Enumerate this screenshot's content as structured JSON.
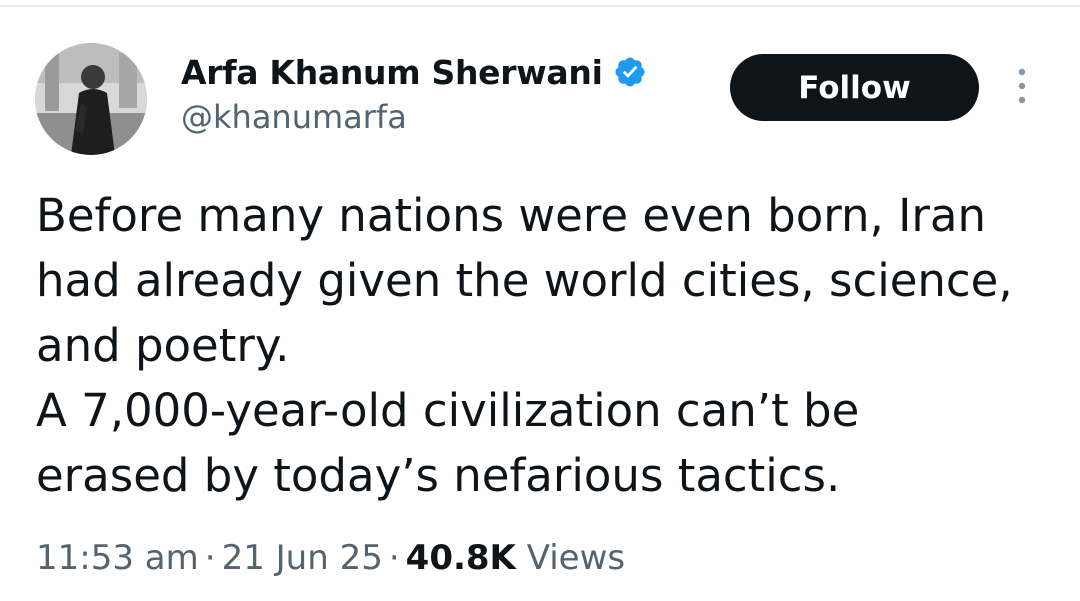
{
  "colors": {
    "text_primary": "#0f1419",
    "text_secondary": "#536471",
    "verified_blue": "#1d9bf0",
    "follow_bg": "#0f1419",
    "follow_text": "#ffffff"
  },
  "author": {
    "display_name": "Arfa Khanum Sherwani",
    "handle": "@khanumarfa",
    "verified": true,
    "verified_icon": "verified-badge-icon",
    "avatar_icon": "profile-avatar"
  },
  "actions": {
    "follow_label": "Follow",
    "more_icon": "more-vertical-icon"
  },
  "tweet": {
    "lines": [
      "Before many nations were even born, Iran",
      "had already given the world cities, science,",
      "and poetry.",
      "A 7,000-year-old civilization can’t be",
      "erased by today’s nefarious tactics."
    ]
  },
  "meta": {
    "time": "11:53 am",
    "separator": "·",
    "date": "21 Jun 25",
    "views_count": "40.8K",
    "views_label": "Views"
  }
}
